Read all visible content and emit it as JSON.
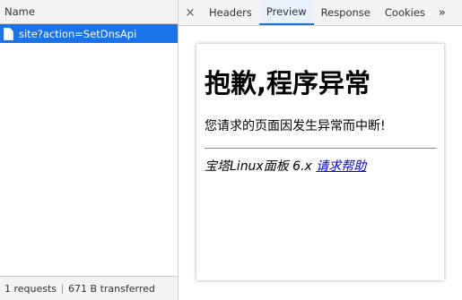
{
  "network": {
    "column_header": "Name",
    "request": {
      "label": "site?action=SetDnsApi"
    },
    "status": {
      "requests": "1 requests",
      "transferred": "671 B transferred"
    }
  },
  "tabs": {
    "close": "×",
    "items": [
      "Headers",
      "Preview",
      "Response",
      "Cookies"
    ],
    "more": "»"
  },
  "preview": {
    "title": "抱歉,程序异常",
    "message": "您请求的页面因发生异常而中断!",
    "footer_text": "宝塔Linux面板 6.x",
    "help_link": "请求帮助"
  },
  "colors": {
    "accent": "#1a73e8",
    "link": "#0000ee"
  }
}
